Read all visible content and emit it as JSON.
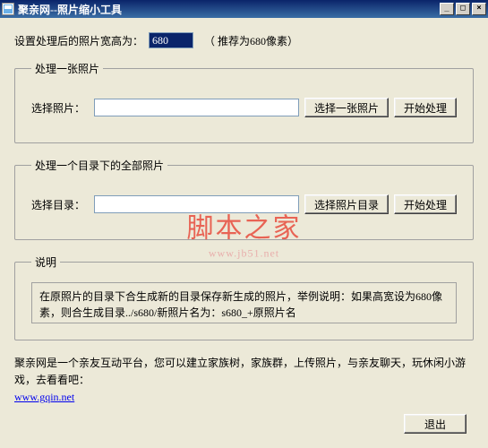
{
  "title": "聚亲网--照片缩小工具",
  "width_row": {
    "label": "设置处理后的照片宽高为：",
    "value": "680",
    "hint": "（ 推荐为680像素）"
  },
  "group_single": {
    "legend": "处理一张照片",
    "field_label": "选择照片：",
    "field_value": "",
    "browse_label": "选择一张照片",
    "process_label": "开始处理"
  },
  "group_batch": {
    "legend": "处理一个目录下的全部照片",
    "field_label": "选择目录：",
    "field_value": "",
    "browse_label": "选择照片目录",
    "process_label": "开始处理"
  },
  "group_desc": {
    "legend": "说明",
    "text": "在原照片的目录下合生成新的目录保存新生成的照片，举例说明：如果高宽设为680像素，则合生成目录../s680/新照片名为：s680_+原照片名"
  },
  "footer": {
    "text": "聚亲网是一个亲友互动平台，您可以建立家族树，家族群，上传照片，与亲友聊天，玩休闲小游戏，去看看吧：",
    "link": "www.gqin.net"
  },
  "exit_label": "退出",
  "watermark": {
    "main": "脚本之家",
    "sub": "www.jb51.net"
  },
  "winbtns": {
    "min": "_",
    "max": "□",
    "close": "×"
  }
}
